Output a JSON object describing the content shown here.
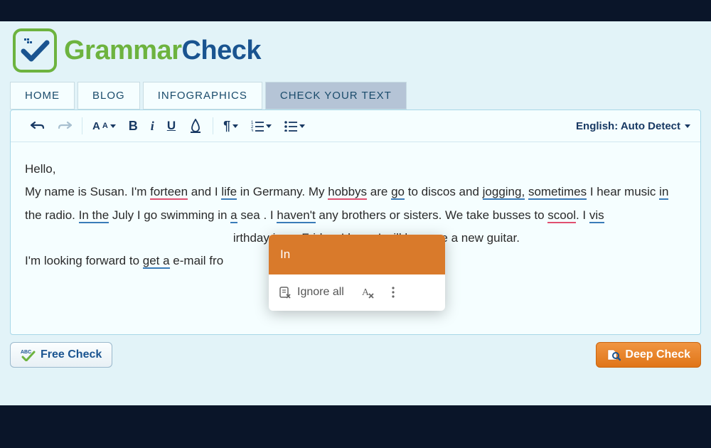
{
  "brand": {
    "part1": "Grammar",
    "part2": "Check"
  },
  "nav": {
    "items": [
      {
        "label": "HOME"
      },
      {
        "label": "BLOG"
      },
      {
        "label": "INFOGRAPHICS"
      },
      {
        "label": "CHECK YOUR TEXT"
      }
    ]
  },
  "toolbar": {
    "language": "English: Auto Detect"
  },
  "content": {
    "line1_a": "Hello,",
    "line2_a": "My name is Susan. I'm ",
    "forteen": "forteen",
    "line2_b": " and I ",
    "life": "life",
    "line2_c": " in Germany. My ",
    "hobbys": "hobbys",
    "line2_d": " are ",
    "go": "go",
    "line2_e": " to discos and ",
    "jogging": "jogging,",
    "sometimes": "sometimes",
    "line3_a": " I hear music ",
    "in_radio": "in",
    "line3_b": " the radio. ",
    "in_the": "In the",
    "line3_c": " July I go swimming in ",
    "a_sea": "a",
    "line3_d": " sea . I ",
    "havent": "haven't",
    "line3_e": " any brothers or sisters. We take busses to ",
    "scool": "scool",
    "line4_a": ". I ",
    "vis": "vis",
    "line4_hidden": "                                                              irthday is on Friday. I hope I will become a new guitar.",
    "line5_a": "I'm looking forward to ",
    "get_a": "get a",
    "line5_b": " e-mail fro"
  },
  "popup": {
    "suggestion": "In",
    "ignore": "Ignore all"
  },
  "footer": {
    "free": "Free Check",
    "deep": "Deep Check"
  }
}
